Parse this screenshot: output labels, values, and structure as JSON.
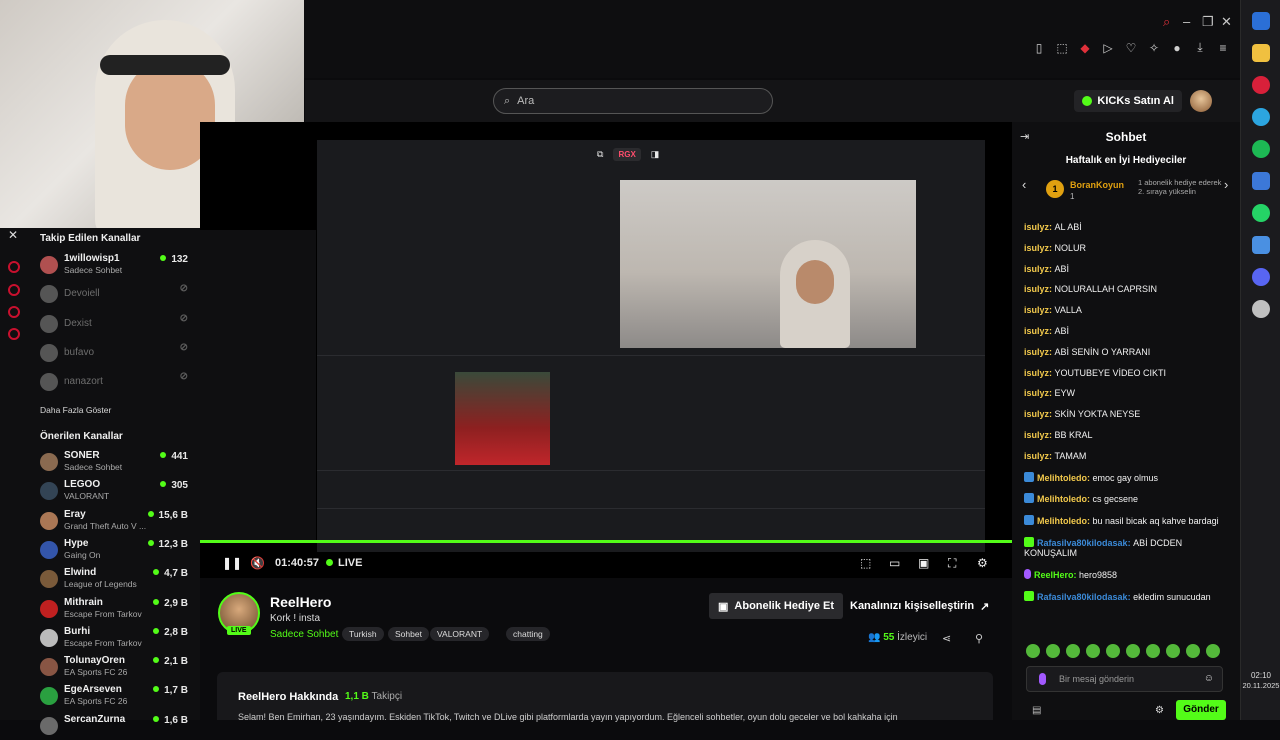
{
  "colors": {
    "kick_green": "#53fc18",
    "gifter_gold": "#e0a010",
    "chat_blue": "#3b8ad8"
  },
  "header": {
    "search_placeholder": "Ara",
    "kicks_label": "KICKs Satın Al"
  },
  "sidebar": {
    "followed_title": "Takip Edilen Kanallar",
    "followed": [
      {
        "name": "1willowisp1",
        "category": "Sadece Sohbet",
        "viewers": "132",
        "color": "#b05050",
        "online": true
      },
      {
        "name": "Devoiell",
        "category": "",
        "viewers": "",
        "color": "#555",
        "online": false
      },
      {
        "name": "Dexist",
        "category": "",
        "viewers": "",
        "color": "#555",
        "online": false
      },
      {
        "name": "bufavo",
        "category": "",
        "viewers": "",
        "color": "#555",
        "online": false
      },
      {
        "name": "nanazort",
        "category": "",
        "viewers": "",
        "color": "#555",
        "online": false
      }
    ],
    "show_more": "Daha Fazla Göster",
    "recommended_title": "Önerilen Kanallar",
    "recommended": [
      {
        "name": "SONER",
        "category": "Sadece Sohbet",
        "viewers": "441",
        "color": "#8a6a50"
      },
      {
        "name": "LEGOO",
        "category": "VALORANT",
        "viewers": "305",
        "color": "#334455"
      },
      {
        "name": "Eray",
        "category": "Grand Theft Auto V ...",
        "viewers": "15,6 B",
        "color": "#aa7755"
      },
      {
        "name": "Hype",
        "category": "Gaing On",
        "viewers": "12,3 B",
        "color": "#3355aa"
      },
      {
        "name": "Elwind",
        "category": "League of Legends",
        "viewers": "4,7 B",
        "color": "#7a5a3a"
      },
      {
        "name": "Mithrain",
        "category": "Escape From Tarkov",
        "viewers": "2,9 B",
        "color": "#c02020"
      },
      {
        "name": "Burhi",
        "category": "Escape From Tarkov",
        "viewers": "2,8 B",
        "color": "#bbbbbb"
      },
      {
        "name": "TolunayOren",
        "category": "EA Sports FC 26",
        "viewers": "2,1 B",
        "color": "#885544"
      },
      {
        "name": "EgeArseven",
        "category": "EA Sports FC 26",
        "viewers": "1,7 B",
        "color": "#2aa040"
      },
      {
        "name": "SercanZurna",
        "category": "",
        "viewers": "1,6 B",
        "color": "#6a6a6a"
      }
    ]
  },
  "player": {
    "time": "01:40:57",
    "live_label": "LIVE",
    "progress": 1.0,
    "inner_badge": "RGX"
  },
  "streamer": {
    "name": "ReelHero",
    "title": "Kork ! insta",
    "category": "Sadece Sohbet",
    "live_badge": "LIVE",
    "tags": [
      "Turkish",
      "Sohbet",
      "VALORANT",
      "chatting"
    ],
    "gift_button": "Abonelik Hediye Et",
    "customize_button": "Kanalınızı kişiselleştirin",
    "viewers": "55",
    "viewers_label": "İzleyici"
  },
  "about": {
    "title": "ReelHero Hakkında",
    "followers": "1,1 B",
    "followers_label": "Takipçi",
    "text": "Selam! Ben Emirhan, 23 yaşındayım. Eskiden TikTok, Twitch ve DLive gibi platformlarda yayın yapıyordum. Eğlenceli sohbetler, oyun dolu geceler ve bol kahkaha için"
  },
  "chat": {
    "title": "Sohbet",
    "gifters_title": "Haftalık en İyi Hediyeciler",
    "gifter_rank": "1",
    "gifter_name": "BoranKoyun",
    "gifter_count": "1",
    "gifter_note": "1 abonelik hediye ederek 2. sıraya yükselin",
    "messages": [
      {
        "user": "isulyz",
        "text": "AL ABİ",
        "color": "#f2c94c",
        "badge": ""
      },
      {
        "user": "isulyz",
        "text": "NOLUR",
        "color": "#f2c94c",
        "badge": ""
      },
      {
        "user": "isulyz",
        "text": "ABİ",
        "color": "#f2c94c",
        "badge": ""
      },
      {
        "user": "isulyz",
        "text": "NOLURALLAH CAPRSIN",
        "color": "#f2c94c",
        "badge": ""
      },
      {
        "user": "isulyz",
        "text": "VALLA",
        "color": "#f2c94c",
        "badge": ""
      },
      {
        "user": "isulyz",
        "text": "ABİ",
        "color": "#f2c94c",
        "badge": ""
      },
      {
        "user": "isulyz",
        "text": "ABİ SENİN O YARRANI",
        "color": "#f2c94c",
        "badge": ""
      },
      {
        "user": "isulyz",
        "text": "YOUTUBEYE VİDEO CIKTI",
        "color": "#f2c94c",
        "badge": ""
      },
      {
        "user": "isulyz",
        "text": "EYW",
        "color": "#f2c94c",
        "badge": ""
      },
      {
        "user": "isulyz",
        "text": "SKİN YOKTA NEYSE",
        "color": "#f2c94c",
        "badge": ""
      },
      {
        "user": "isulyz",
        "text": "BB KRAL",
        "color": "#f2c94c",
        "badge": ""
      },
      {
        "user": "isulyz",
        "text": "TAMAM",
        "color": "#f2c94c",
        "badge": ""
      },
      {
        "user": "Melihtoledo",
        "text": "emoc gay olmus",
        "color": "#f2c94c",
        "badge": "blue"
      },
      {
        "user": "Melihtoledo",
        "text": "cs gecsene",
        "color": "#f2c94c",
        "badge": "blue"
      },
      {
        "user": "Melihtoledo",
        "text": "bu nasil bicak aq kahve bardagi",
        "color": "#f2c94c",
        "badge": "blue"
      },
      {
        "user": "Rafasilva80kilodasak",
        "text": "ABİ DCDEN KONUŞALIM",
        "color": "#3b8ad8",
        "badge": "gift"
      },
      {
        "user": "ReelHero",
        "text": "hero9858",
        "color": "#53fc18",
        "badge": "sub"
      },
      {
        "user": "Rafasilva80kilodasak",
        "text": "ekledim sunucudan",
        "color": "#3b8ad8",
        "badge": "gift"
      }
    ],
    "input_placeholder": "Bir mesaj gönderin",
    "send_label": "Gönder"
  },
  "clock": {
    "time": "02:10",
    "date": "20.11.2025"
  }
}
